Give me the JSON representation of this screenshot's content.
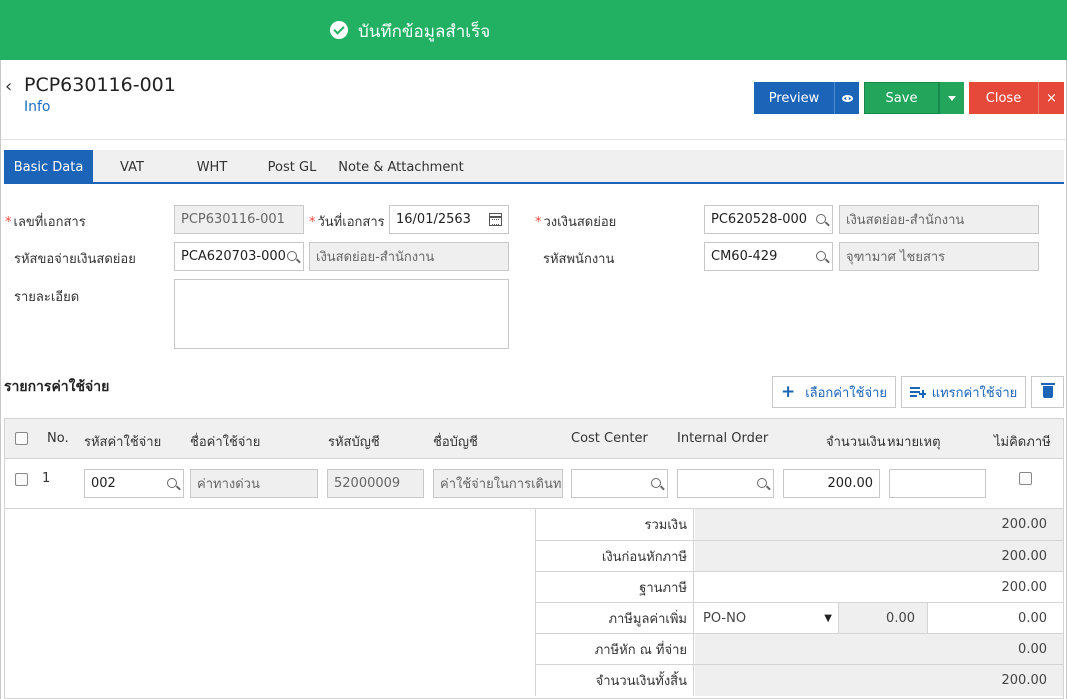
{
  "toast": {
    "message": "บันทึกข้อมูลสำเร็จ"
  },
  "header": {
    "title": "PCP630116-001",
    "subtitle": "Info"
  },
  "actions": {
    "preview": "Preview",
    "save": "Save",
    "close": "Close",
    "close_x": "×"
  },
  "tabs": [
    {
      "label": "Basic Data",
      "active": true
    },
    {
      "label": "VAT"
    },
    {
      "label": "WHT"
    },
    {
      "label": "Post GL"
    },
    {
      "label": "Note & Attachment"
    }
  ],
  "form": {
    "doc_no": {
      "label": "เลขที่เอกสาร",
      "value": "PCP630116-001"
    },
    "doc_date": {
      "label": "วันที่เอกสาร",
      "value": "16/01/2563"
    },
    "petty_cash": {
      "label": "วงเงินสดย่อย",
      "code": "PC620528-000",
      "name": "เงินสดย่อย-สำนักงาน"
    },
    "request_no": {
      "label": "รหัสขอจ่ายเงินสดย่อย",
      "code": "PCA620703-000",
      "name": "เงินสดย่อย-สำนักงาน"
    },
    "employee": {
      "label": "รหัสพนักงาน",
      "code": "CM60-429",
      "name": "จุฑามาศ ไชยสาร"
    },
    "description": {
      "label": "รายละเอียด",
      "value": ""
    }
  },
  "expenses": {
    "title": "รายการค่าใช้จ่าย",
    "select_button": "เลือกค่าใช้จ่าย",
    "insert_button": "แทรกค่าใช้จ่าย",
    "columns": [
      "No.",
      "รหัสค่าใช้จ่าย",
      "ชื่อค่าใช้จ่าย",
      "รหัสบัญชี",
      "ชื่อบัญชี",
      "Cost Center",
      "Internal Order",
      "จำนวนเงิน",
      "หมายเหตุ",
      "ไม่คิดภาษี"
    ],
    "rows": [
      {
        "no": "1",
        "code": "002",
        "name": "ค่าทางด่วน",
        "account_code": "52000009",
        "account_name": "ค่าใช้จ่ายในการเดินท",
        "cost_center": "",
        "internal_order": "",
        "amount": "200.00",
        "remark": "",
        "no_tax": false
      }
    ]
  },
  "summary": {
    "total": {
      "label": "รวมเงิน",
      "value": "200.00"
    },
    "before_tax": {
      "label": "เงินก่อนหักภาษี",
      "value": "200.00"
    },
    "tax_base": {
      "label": "ฐานภาษี",
      "value": "200.00"
    },
    "vat": {
      "label": "ภาษีมูลค่าเพิ่ม",
      "type": "PO-NO",
      "rate": "0.00",
      "value": "0.00"
    },
    "wht": {
      "label": "ภาษีหัก ณ ที่จ่าย",
      "value": "0.00"
    },
    "grand_total": {
      "label": "จำนวนเงินทั้งสิ้น",
      "value": "200.00"
    }
  }
}
